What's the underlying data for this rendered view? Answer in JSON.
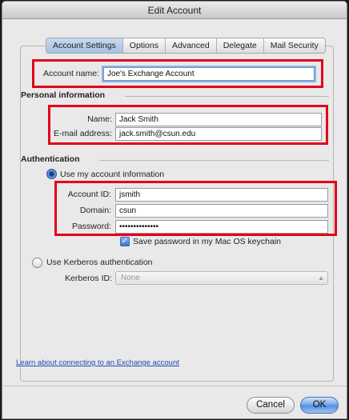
{
  "window": {
    "title": "Edit Account"
  },
  "tabs": [
    {
      "label": "Account Settings",
      "active": true
    },
    {
      "label": "Options",
      "active": false
    },
    {
      "label": "Advanced",
      "active": false
    },
    {
      "label": "Delegate",
      "active": false
    },
    {
      "label": "Mail Security",
      "active": false
    }
  ],
  "account": {
    "name_label": "Account name:",
    "name_value": "Joe's Exchange Account"
  },
  "personal": {
    "section_title": "Personal information",
    "name_label": "Name:",
    "name_value": "Jack Smith",
    "email_label": "E-mail address:",
    "email_value": "jack.smith@csun.edu"
  },
  "auth": {
    "section_title": "Authentication",
    "use_account_label": "Use my account information",
    "account_id_label": "Account ID:",
    "account_id_value": "jsmith",
    "domain_label": "Domain:",
    "domain_value": "csun",
    "password_label": "Password:",
    "password_value": "••••••••••••••",
    "save_password_label": "Save password in my Mac OS keychain",
    "kerberos_label": "Use Kerberos authentication",
    "kerberos_id_label": "Kerberos ID:",
    "kerberos_id_value": "None"
  },
  "footer": {
    "learn_link": "Learn about connecting to an Exchange account",
    "cancel_label": "Cancel",
    "ok_label": "OK"
  },
  "colors": {
    "highlight_red": "#e3001b",
    "link_blue": "#2348b6",
    "primary_blue": "#4f8ee0"
  }
}
